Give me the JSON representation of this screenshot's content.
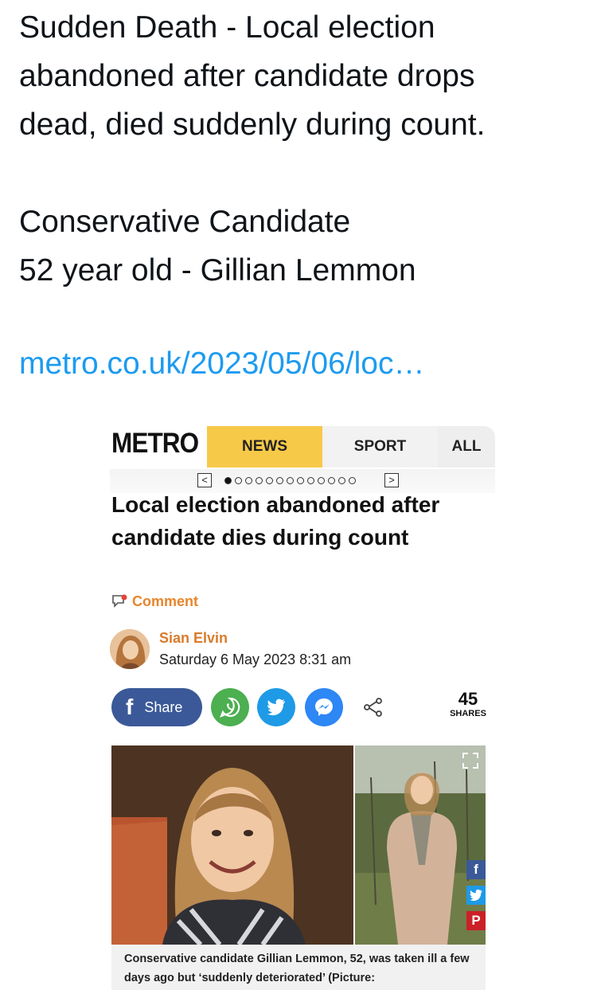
{
  "tweet": {
    "lines": [
      "Sudden Death - Local election",
      "abandoned after candidate drops",
      "dead, died suddenly during count.",
      "Conservative Candidate",
      "52 year old - Gillian Lemmon"
    ],
    "link": "metro.co.uk/2023/05/06/loc…"
  },
  "article": {
    "logo": "METRO",
    "nav": {
      "news": "NEWS",
      "sport": "SPORT",
      "all": "ALL"
    },
    "pager": {
      "prev": "<",
      "next": ">",
      "total_dots": 13,
      "active_dot": 1
    },
    "headline": "Local election abandoned after candidate dies during count",
    "comment_label": "Comment",
    "author": {
      "name": "Sian Elvin",
      "date": "Saturday 6 May 2023 8:31 am"
    },
    "share": {
      "fb_label": "Share",
      "count": "45",
      "count_label": "SHARES"
    },
    "caption": "Conservative candidate Gillian Lemmon, 52, was taken ill a few days ago but ‘suddenly deteriorated’ (Picture:",
    "colors": {
      "nav_accent": "#f7c948",
      "link": "#1d9bf0",
      "author": "#d97b2a",
      "facebook": "#3b5998",
      "whatsapp": "#4caf50",
      "twitter": "#1e9ae6",
      "messenger": "#2d87f5",
      "pinterest": "#cb2027"
    }
  }
}
